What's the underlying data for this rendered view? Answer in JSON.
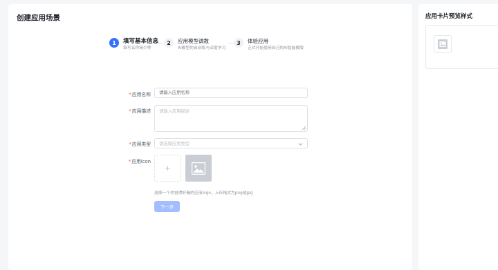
{
  "page": {
    "title": "创建应用场景",
    "side_title": "应用卡片预览样式"
  },
  "steps": [
    {
      "number": "1",
      "title": "填写基本信息",
      "desc": "填写名称简介等",
      "active": true
    },
    {
      "number": "2",
      "title": "应用模型调教",
      "desc": "AI模型的自训练与深度学习",
      "active": false
    },
    {
      "number": "3",
      "title": "体验应用",
      "desc": "正式开始使用自己的AI智能模版",
      "active": false
    }
  ],
  "form": {
    "name": {
      "label": "应用名称",
      "placeholder": "请输入应用名称"
    },
    "description": {
      "label": "应用描述",
      "placeholder": "请输入应用描述"
    },
    "type": {
      "label": "应用类型",
      "placeholder": "请选择应用类型"
    },
    "icon": {
      "label": "应用icon",
      "upload_symbol": "+"
    },
    "hint": "选择一个你觉得好看的应用logo，上传格式为png或jpg",
    "next_label": "下一步"
  },
  "colors": {
    "accent": "#3370ff",
    "button_disabled": "#a3beff",
    "required": "#f54a45"
  }
}
